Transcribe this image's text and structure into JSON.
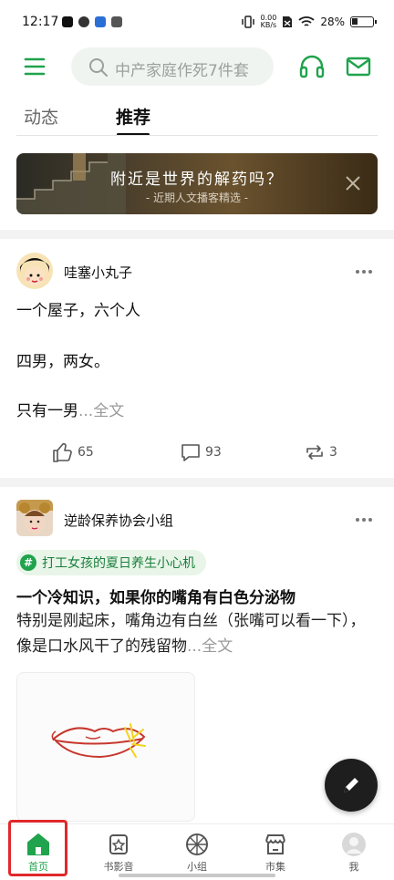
{
  "status_bar": {
    "time": "12:17",
    "speed": "0.00",
    "speed_unit": "KB/s",
    "battery": "28%"
  },
  "header": {
    "search_placeholder": "中产家庭作死7件套",
    "icons": [
      "menu-icon",
      "search-icon",
      "headset-icon",
      "mail-icon"
    ]
  },
  "tabs": [
    {
      "label": "动态",
      "active": false
    },
    {
      "label": "推荐",
      "active": true
    }
  ],
  "banner": {
    "title": "附近是世界的解药吗？",
    "subtitle": "- 近期人文播客精选 -"
  },
  "posts": [
    {
      "username": "哇塞小丸子",
      "lines": [
        "一个屋子，六个人",
        "四男，两女。"
      ],
      "last_line": "只有一男",
      "ellipsis": "...",
      "fulltext_label": "全文",
      "likes": "65",
      "comments": "93",
      "reposts": "3"
    },
    {
      "username": "逆龄保养协会小组",
      "topic": "打工女孩的夏日养生小心机",
      "title": "一个冷知识，如果你的嘴角有白色分泌物",
      "body": "特别是刚起床，嘴角边有白丝（张嘴可以看一下），像是口水风干了的残留物",
      "ellipsis": "...",
      "fulltext_label": "全文"
    }
  ],
  "bottom_nav": [
    {
      "label": "首页",
      "icon": "home-icon",
      "active": true
    },
    {
      "label": "书影音",
      "icon": "star-card-icon",
      "active": false
    },
    {
      "label": "小组",
      "icon": "group-icon",
      "active": false
    },
    {
      "label": "市集",
      "icon": "market-icon",
      "active": false
    },
    {
      "label": "我",
      "icon": "avatar-icon",
      "active": false
    }
  ],
  "colors": {
    "brand_green": "#1fa34c",
    "highlight_red": "#e0282a"
  }
}
